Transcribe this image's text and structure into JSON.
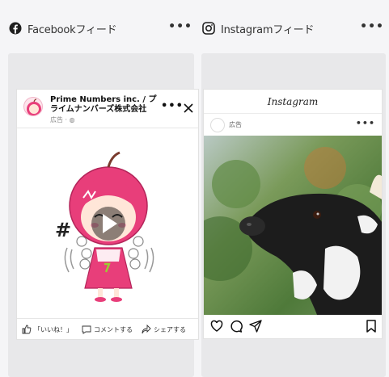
{
  "columns": {
    "facebook": {
      "title": "Facebookフィード",
      "icon": "facebook-icon",
      "more": "•••"
    },
    "instagram": {
      "title": "Instagramフィード",
      "icon": "instagram-icon",
      "more": "•••"
    }
  },
  "facebook_post": {
    "page_name": "Prime Numbers inc. / プライムナンバーズ株式会社",
    "sponsored": "広告 · ",
    "more": "•••",
    "hash": "#",
    "actions": {
      "like": "「いいね！」",
      "comment": "コメントする",
      "share": "シェアする"
    }
  },
  "instagram_post": {
    "logo": "Instagram",
    "sponsored": "広告",
    "more": "•••"
  },
  "colors": {
    "background": "#f5f5f7",
    "panel": "#e8e8ea",
    "mascot_pink": "#e83e7a"
  }
}
